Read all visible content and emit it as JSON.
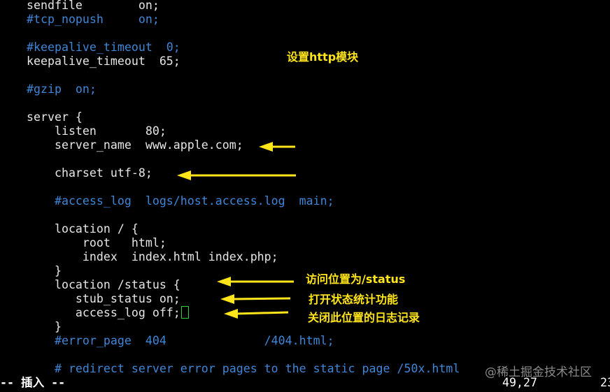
{
  "editor": {
    "lines": [
      {
        "text": "sendfile        on;",
        "comment": false
      },
      {
        "text": "#tcp_nopush     on;",
        "comment": true
      },
      {
        "text": "",
        "comment": false
      },
      {
        "text": "#keepalive_timeout  0;",
        "comment": true
      },
      {
        "text": "keepalive_timeout  65;",
        "comment": false
      },
      {
        "text": "",
        "comment": false
      },
      {
        "text": "#gzip  on;",
        "comment": true
      },
      {
        "text": "",
        "comment": false
      },
      {
        "text": "server {",
        "comment": false
      },
      {
        "text": "    listen       80;",
        "comment": false
      },
      {
        "text": "    server_name  www.apple.com;",
        "comment": false
      },
      {
        "text": "",
        "comment": false
      },
      {
        "text": "    charset utf-8;",
        "comment": false
      },
      {
        "text": "",
        "comment": false
      },
      {
        "text": "    #access_log  logs/host.access.log  main;",
        "comment": true
      },
      {
        "text": "",
        "comment": false
      },
      {
        "text": "    location / {",
        "comment": false
      },
      {
        "text": "        root   html;",
        "comment": false
      },
      {
        "text": "        index  index.html index.php;",
        "comment": false
      },
      {
        "text": "    }",
        "comment": false
      },
      {
        "text": "    location /status {",
        "comment": false
      },
      {
        "text": "       stub_status on;",
        "comment": false
      },
      {
        "text": "       access_log off;",
        "comment": false,
        "cursor": true
      },
      {
        "text": "    }",
        "comment": false
      },
      {
        "text": "    #error_page  404              /404.html;",
        "comment": true
      },
      {
        "text": "",
        "comment": false
      },
      {
        "text": "    # redirect server error pages to the static page /50x.html",
        "comment": true
      }
    ]
  },
  "annotations": {
    "http_module": "设置http模块",
    "status_location": "访问位置为/status",
    "stub_status": "打开状态统计功能",
    "access_log_off": "关闭此位置的日志记录"
  },
  "statusbar": {
    "mode": "-- 插入 --",
    "position": "49,27",
    "percent": "23"
  },
  "watermark": "@稀土掘金技术社区",
  "colors": {
    "comment": "#3f86d6",
    "text": "#e6e6e6",
    "annotation": "#ffe51a",
    "cursor": "#2fcf3f"
  }
}
